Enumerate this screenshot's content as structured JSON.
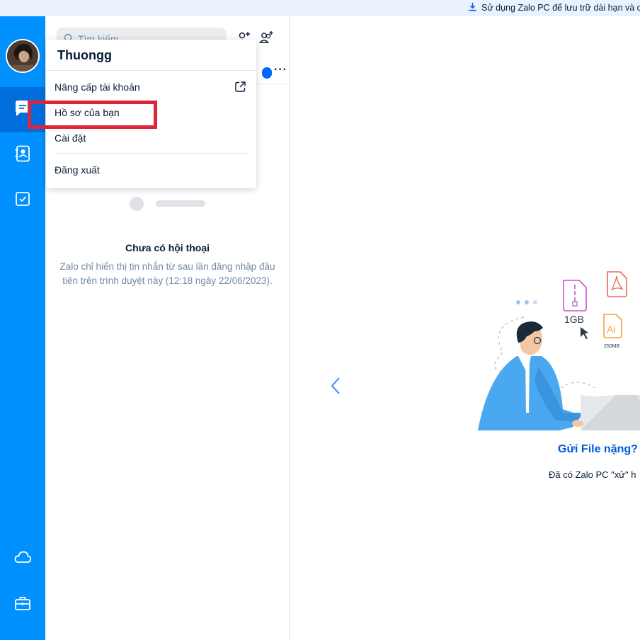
{
  "banner": {
    "text": "Sử dụng Zalo PC để lưu trữ dài hạn và c",
    "icon": "download-icon"
  },
  "nav": {
    "items": [
      {
        "name": "messages",
        "icon": "chat-icon",
        "active": true
      },
      {
        "name": "contacts",
        "icon": "contacts-icon",
        "active": false
      },
      {
        "name": "todo",
        "icon": "checkbox-icon",
        "active": false
      },
      {
        "name": "cloud",
        "icon": "cloud-icon",
        "active": false
      },
      {
        "name": "tools",
        "icon": "briefcase-icon",
        "active": false
      }
    ],
    "accent": "#0091ff",
    "active_bg": "#006edc"
  },
  "search": {
    "placeholder": "Tìm kiếm"
  },
  "menu": {
    "user_name": "Thuongg",
    "items": [
      {
        "label": "Nâng cấp tài khoản",
        "icon": "external-link-icon"
      },
      {
        "label": "Hồ sơ của bạn"
      },
      {
        "label": "Cài đặt"
      },
      {
        "label": "Đăng xuất"
      }
    ],
    "highlight_color": "#e0243a"
  },
  "empty_state": {
    "title": "Chưa có hội thoại",
    "description": "Zalo chỉ hiển thị tin nhắn từ sau lần đăng nhập đầu tiên trên trình duyệt này (12:18 ngày 22/06/2023)."
  },
  "promo": {
    "title": "Gửi File nặng?",
    "description": "Đã có Zalo PC \"xử\" h",
    "file_size_label": "1GB",
    "ai_label": "Ai",
    "ai_size": "250MB"
  }
}
